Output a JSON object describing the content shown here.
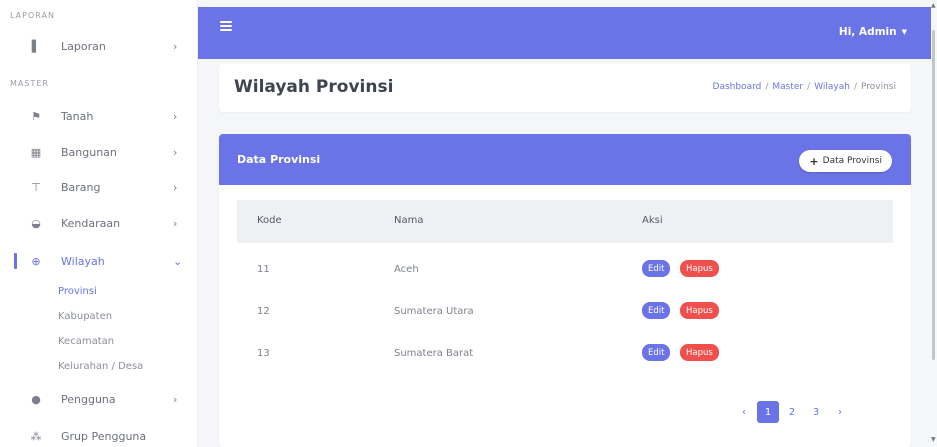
{
  "sidebar": {
    "section_laporan": "LAPORAN",
    "section_master": "MASTER",
    "items": {
      "laporan": {
        "label": "Laporan",
        "icon": "file-icon"
      },
      "tanah": {
        "label": "Tanah",
        "icon": "flag-icon"
      },
      "bangunan": {
        "label": "Bangunan",
        "icon": "building-icon"
      },
      "barang": {
        "label": "Barang",
        "icon": "cart-icon"
      },
      "kendaraan": {
        "label": "Kendaraan",
        "icon": "car-icon"
      },
      "wilayah": {
        "label": "Wilayah",
        "icon": "globe-icon"
      },
      "pengguna": {
        "label": "Pengguna",
        "icon": "user-icon"
      },
      "grup_pengguna": {
        "label": "Grup Pengguna",
        "icon": "users-icon"
      }
    },
    "wilayah_sub": [
      "Provinsi",
      "Kabupaten",
      "Kecamatan",
      "Kelurahan / Desa"
    ]
  },
  "topbar": {
    "user_label": "Hi, Admin"
  },
  "page": {
    "title": "Wilayah Provinsi",
    "breadcrumb": [
      "Dashboard",
      "Master",
      "Wilayah",
      "Provinsi"
    ]
  },
  "card": {
    "title": "Data Provinsi",
    "add_button": "Data Provinsi"
  },
  "table": {
    "columns": [
      "Kode",
      "Nama",
      "Aksi"
    ],
    "rows": [
      {
        "kode": "11",
        "nama": "Aceh"
      },
      {
        "kode": "12",
        "nama": "Sumatera Utara"
      },
      {
        "kode": "13",
        "nama": "Sumatera Barat"
      }
    ],
    "edit_label": "Edit",
    "hapus_label": "Hapus"
  },
  "pagination": {
    "prev": "‹",
    "pages": [
      "1",
      "2",
      "3"
    ],
    "next": "›",
    "current": "1"
  },
  "colors": {
    "primary": "#6a74e6",
    "danger": "#f0504d"
  }
}
